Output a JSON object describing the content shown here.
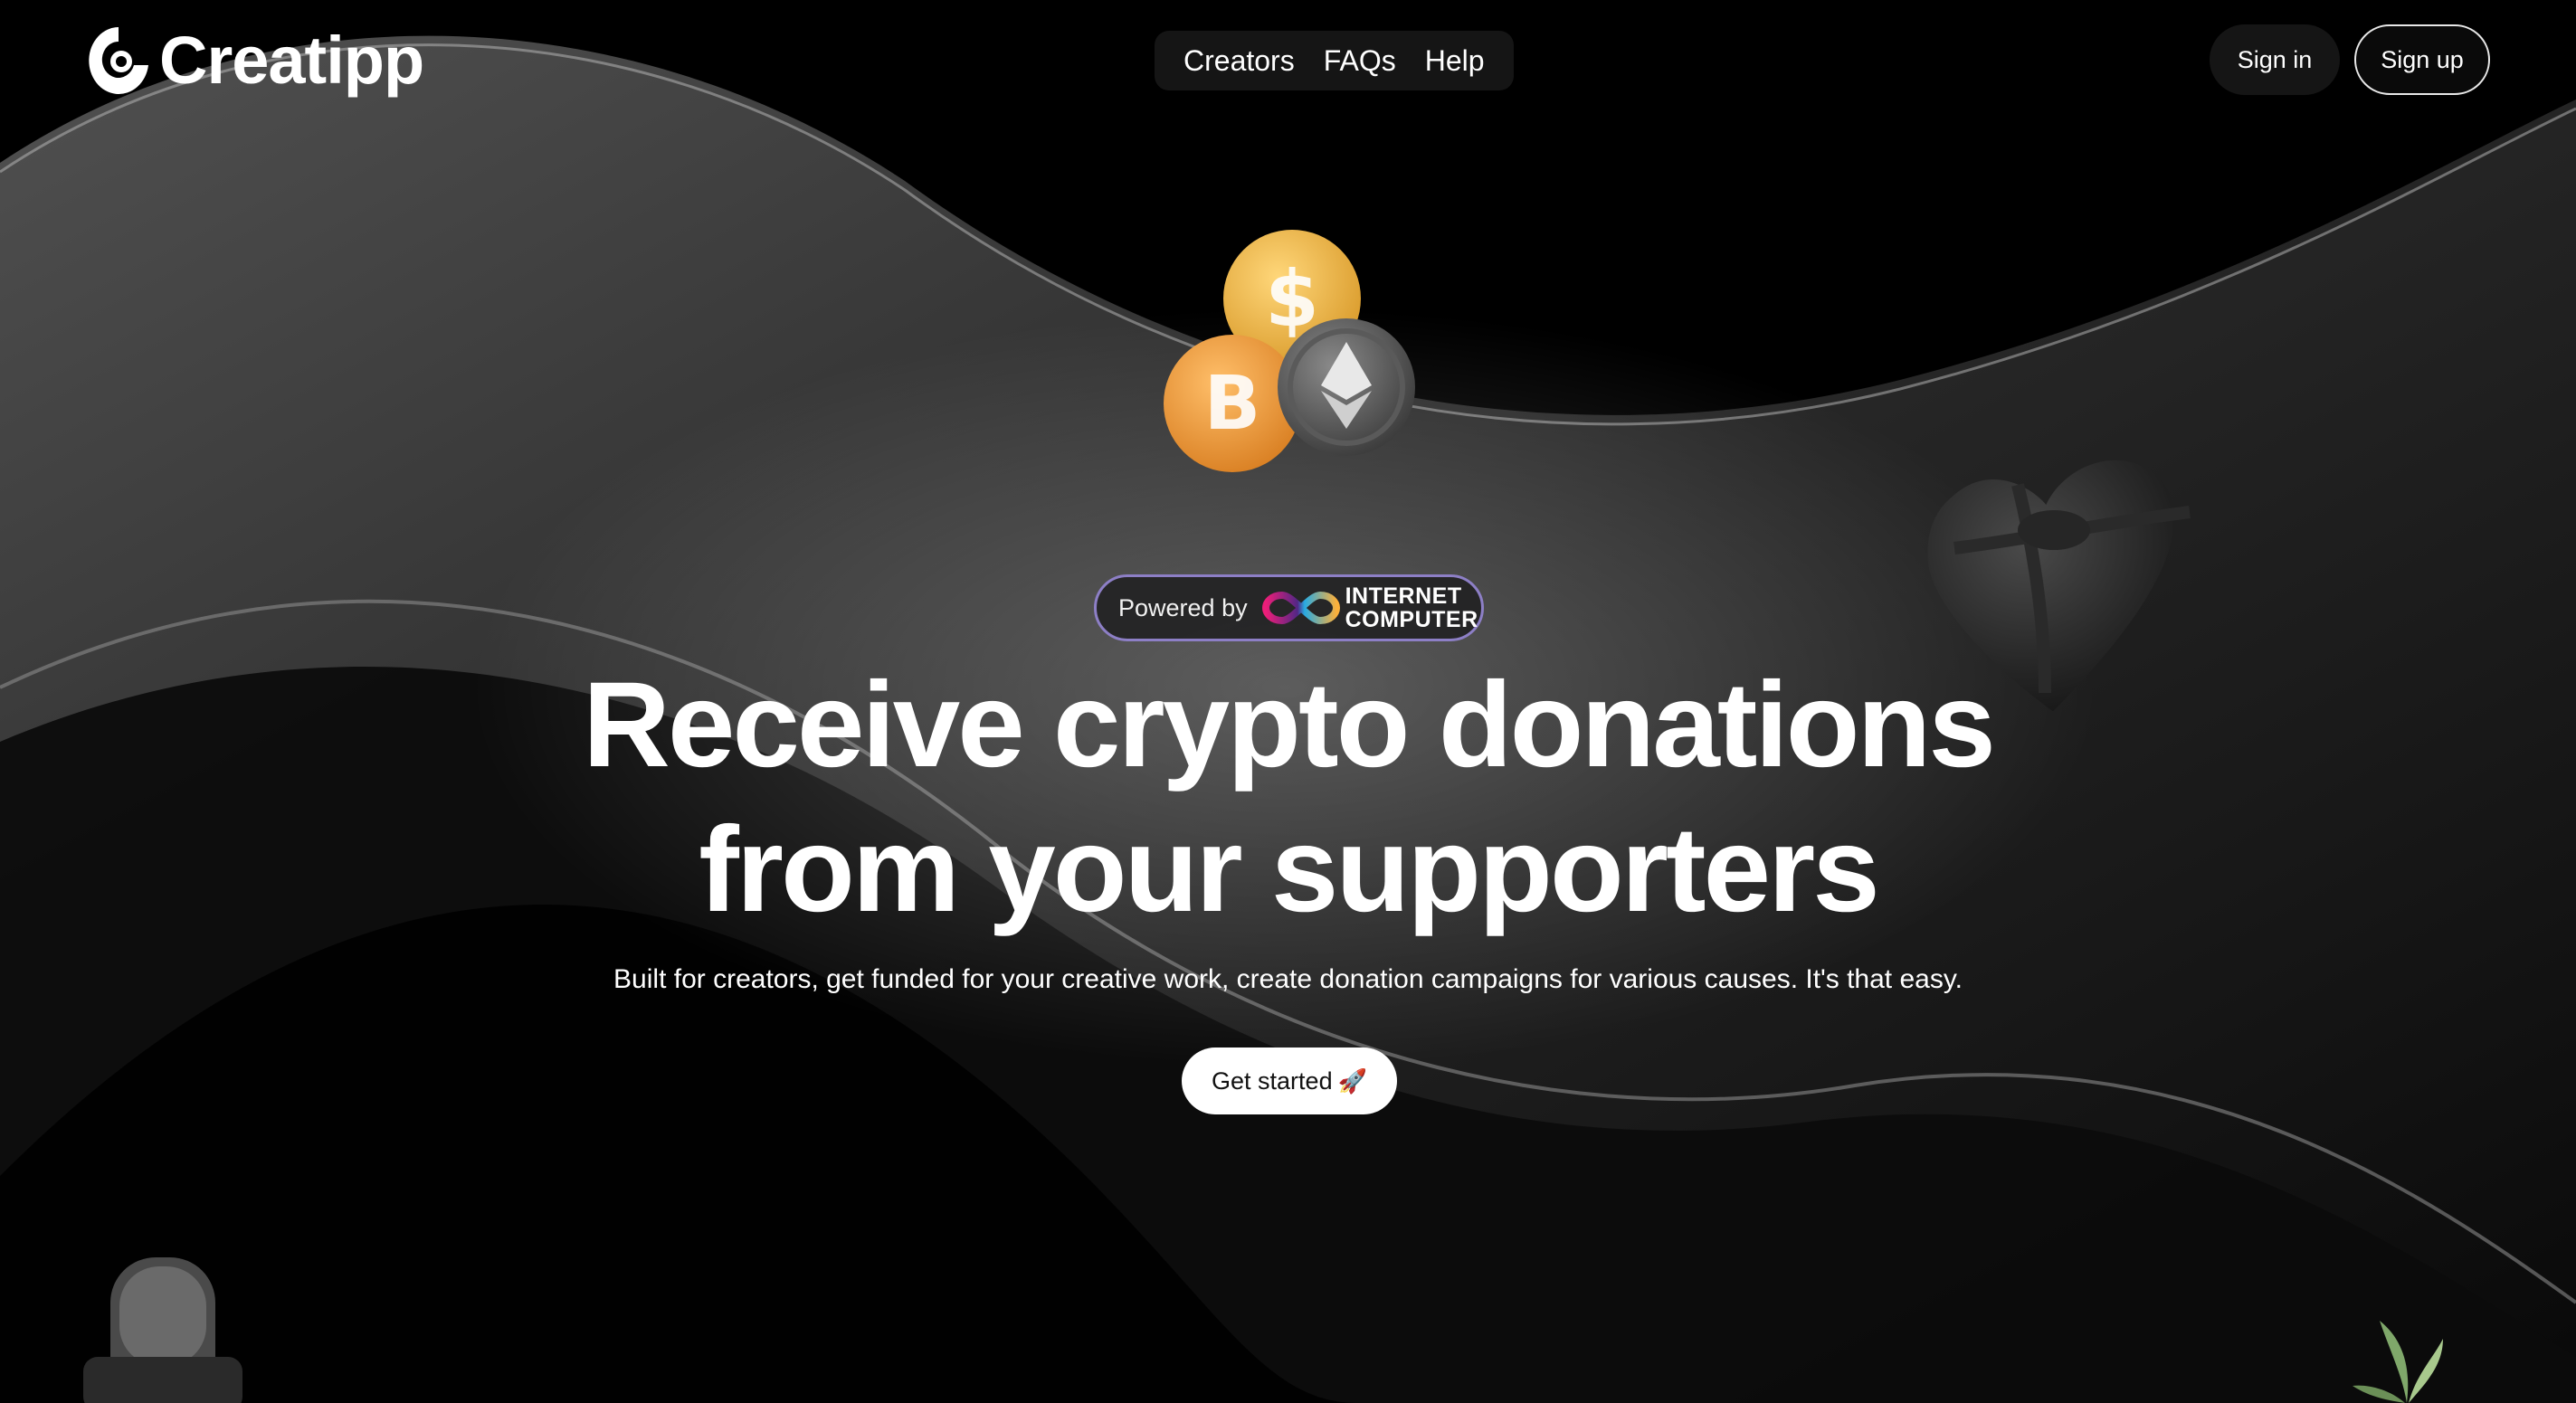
{
  "brand": {
    "name": "Creatipp"
  },
  "nav": {
    "items": [
      "Creators",
      "FAQs",
      "Help"
    ]
  },
  "auth": {
    "sign_in": "Sign in",
    "sign_up": "Sign up"
  },
  "badge": {
    "prefix": "Powered by",
    "partner_line1": "INTERNET",
    "partner_line2": "COMPUTER"
  },
  "hero": {
    "headline_line1": "Receive crypto donations",
    "headline_line2": "from your supporters",
    "subtitle": "Built for creators, get funded for your creative work, create donation campaigns for various causes. It's that easy.",
    "cta_label": "Get started",
    "cta_icon": "rocket-icon"
  },
  "colors": {
    "background": "#000000",
    "nav_bg": "#151515",
    "badge_border": "#8d7fc6",
    "cta_bg": "#ffffff"
  },
  "decorations": [
    "coins-icon",
    "gift-heart-icon",
    "microphone-icon",
    "plant-icon"
  ]
}
